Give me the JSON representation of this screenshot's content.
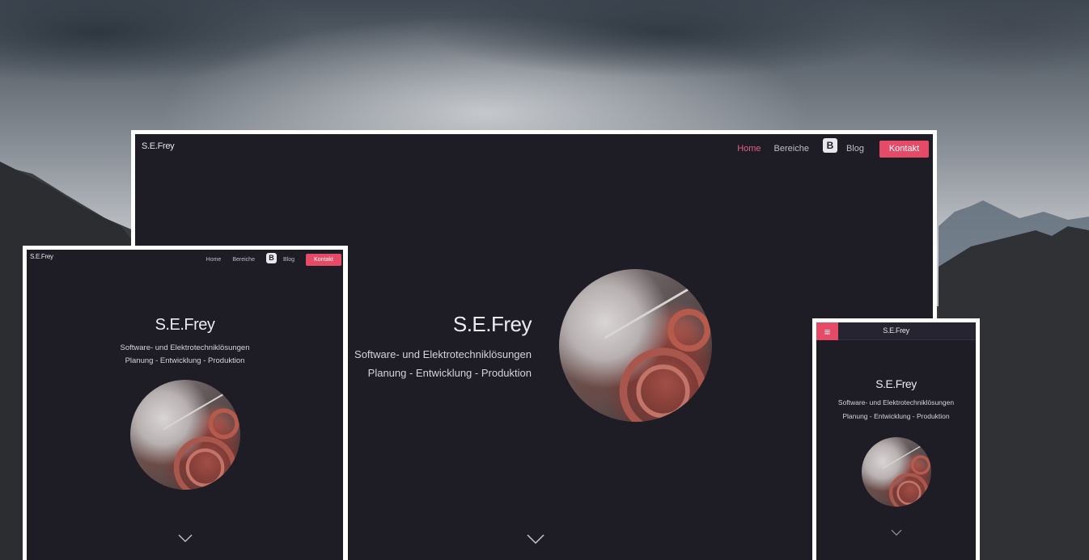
{
  "site": {
    "brand": "S.E.Frey",
    "title": "S.E.Frey",
    "subtitle_line1": "Software- und Elektrotechniklösungen",
    "subtitle_line2": "Planung - Entwicklung - Produktion"
  },
  "nav": {
    "items": [
      {
        "label": "Home",
        "active": true
      },
      {
        "label": "Bereiche",
        "active": false
      }
    ],
    "blog_icon_glyph": "B",
    "blog_label": "Blog",
    "contact_label": "Kontakt"
  },
  "mobile": {
    "hamburger_glyph": "≡"
  },
  "icons": {
    "blog": "blogger-icon",
    "scroll_down": "chevron-down-icon",
    "menu": "hamburger-menu-icon"
  },
  "colors": {
    "accent": "#e54b66",
    "screen_bg": "#1e1d26",
    "frame": "#ffffff"
  }
}
